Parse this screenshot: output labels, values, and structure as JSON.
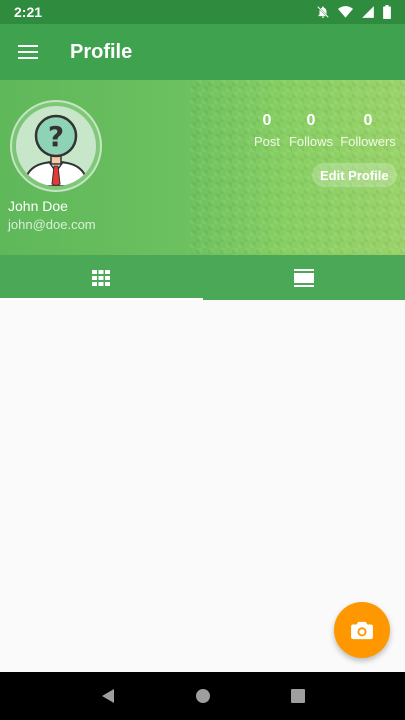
{
  "status_bar": {
    "time": "2:21",
    "icons": [
      "notifications-off-icon",
      "wifi-icon",
      "signal-icon",
      "battery-icon"
    ]
  },
  "app_bar": {
    "title": "Profile",
    "menu_icon": "menu-icon"
  },
  "profile": {
    "name": "John Doe",
    "email": "john@doe.com",
    "avatar_icon": "unknown-user-avatar"
  },
  "stats": [
    {
      "count": "0",
      "label": "Post"
    },
    {
      "count": "0",
      "label": "Follows"
    },
    {
      "count": "0",
      "label": "Followers"
    }
  ],
  "edit_profile_label": "Edit Profile",
  "tabs": [
    {
      "icon": "grid-icon",
      "selected": true
    },
    {
      "icon": "list-icon",
      "selected": false
    }
  ],
  "fab_icon": "camera-icon",
  "colors": {
    "status_bar": "#2f8b3e",
    "app_bar": "#3ea24f",
    "tabs": "#4aa857",
    "fab": "#ff9800",
    "content_bg": "#fafafa"
  }
}
